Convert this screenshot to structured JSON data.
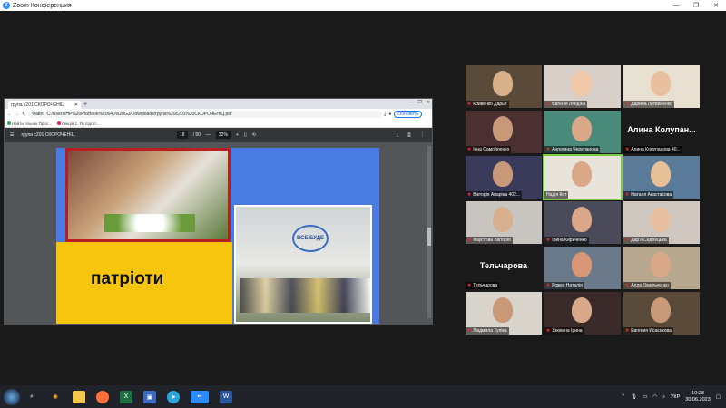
{
  "window": {
    "title": "Zoom Конференция",
    "logo_letter": "Z"
  },
  "browser": {
    "tab_title": "група с201 СКОРОЧЕНІЦ",
    "address": "C:/Users/HP%20ProBook%20640%20G3/Downloads/група%20с201%20СКОРОЧЕНІЦ.pdf",
    "address_prefix": "Файл",
    "update_label": "Обновить",
    "bookmarks": [
      "Найти ельник Прос...",
      "Лекція 1. Як підгот..."
    ]
  },
  "pdf": {
    "filename": "група с201 СКОРОЧЕНІЦ",
    "page_current": "18",
    "page_total": "/ 50",
    "zoom": "32%",
    "slide_text": "патріоти",
    "logo_text": "ВСЕ БУДЕ"
  },
  "participants": [
    {
      "name": "Кривенко Дарья",
      "muted": true,
      "bg": "#5a4a3a",
      "face": "#d8b08a"
    },
    {
      "name": "Євгенія Ляндіна",
      "muted": true,
      "bg": "#d8d0c8",
      "face": "#f0c8a8"
    },
    {
      "name": "Дарина Летвиненко",
      "muted": true,
      "bg": "#e8e0d0",
      "face": "#e8c0a0"
    },
    {
      "name": "Інна Самойленко",
      "muted": true,
      "bg": "#4a3030",
      "face": "#c89878"
    },
    {
      "name": "Ангелина Черепанова",
      "muted": true,
      "bg": "#4a8a7a",
      "face": "#d8a888"
    },
    {
      "name": "Алина Колупанова 40...",
      "muted": true,
      "bg": "#1a1a1a",
      "face": "",
      "big_name": "Алина Колупан..."
    },
    {
      "name": "Вікторія Апаріна 402...",
      "muted": true,
      "bg": "#3a3a5a",
      "face": "#c89878"
    },
    {
      "name": "Надія Кот",
      "muted": false,
      "bg": "#e8e4dc",
      "face": "#d8a888",
      "active": true
    },
    {
      "name": "Наталя Акастасова",
      "muted": true,
      "bg": "#5a7a9a",
      "face": "#e8c098"
    },
    {
      "name": "Фаустова Вікторія",
      "muted": true,
      "bg": "#c8c4c0",
      "face": "#d8b090"
    },
    {
      "name": "Ірина Кириченко",
      "muted": true,
      "bg": "#4a4a5a",
      "face": "#d8a888"
    },
    {
      "name": "Дар'я Седлецька",
      "muted": true,
      "bg": "#d0c8c0",
      "face": "#e8c0a0"
    },
    {
      "name": "Тельчарова",
      "muted": true,
      "bg": "#1a1a1a",
      "face": "",
      "big_name": "Тельчарова"
    },
    {
      "name": "Рожко Наталія",
      "muted": true,
      "bg": "#6a7a8a",
      "face": "#d89878"
    },
    {
      "name": "Алла Омельченко",
      "muted": true,
      "bg": "#b8a890",
      "face": "#d8a888"
    },
    {
      "name": "Людмила Тупіка",
      "muted": true,
      "bg": "#d8d4cc",
      "face": "#c89878"
    },
    {
      "name": "Узюкина Ірина",
      "muted": true,
      "bg": "#3a2a2a",
      "face": "#d8a888"
    },
    {
      "name": "Евгения Исаєнкова",
      "muted": true,
      "bg": "#5a4a3a",
      "face": "#c89878"
    }
  ],
  "taskbar": {
    "language": "УКР",
    "time": "10:28",
    "date": "30.06.2023"
  }
}
